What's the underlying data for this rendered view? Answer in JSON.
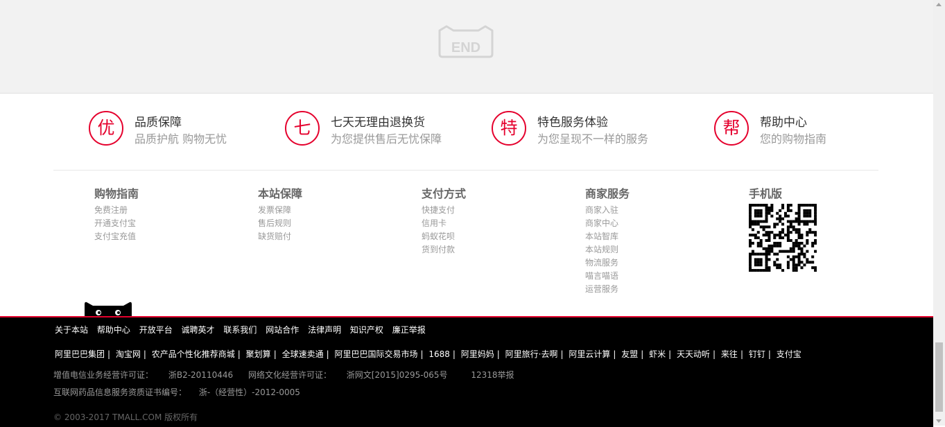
{
  "end_banner": {
    "text": "END"
  },
  "services": [
    {
      "icon_char": "优",
      "title": "品质保障",
      "subtitle": "品质护航 购物无忧"
    },
    {
      "icon_char": "七",
      "title": "七天无理由退换货",
      "subtitle": "为您提供售后无忧保障"
    },
    {
      "icon_char": "特",
      "title": "特色服务体验",
      "subtitle": "为您呈现不一样的服务"
    },
    {
      "icon_char": "帮",
      "title": "帮助中心",
      "subtitle": "您的购物指南"
    }
  ],
  "columns": [
    {
      "title": "购物指南",
      "links": [
        "免费注册",
        "开通支付宝",
        "支付宝充值"
      ]
    },
    {
      "title": "本站保障",
      "links": [
        "发票保障",
        "售后规则",
        "缺货赔付"
      ]
    },
    {
      "title": "支付方式",
      "links": [
        "快捷支付",
        "信用卡",
        "蚂蚁花呗",
        "货到付款"
      ]
    },
    {
      "title": "商家服务",
      "links": [
        "商家入驻",
        "商家中心",
        "本站智库",
        "本站规则",
        "物流服务",
        "喵言喵语",
        "运营服务"
      ]
    },
    {
      "title": "手机版",
      "qr": "qr-code"
    }
  ],
  "footer": {
    "links": [
      "关于本站",
      "帮助中心",
      "开放平台",
      "诚聘英才",
      "联系我们",
      "网站合作",
      "法律声明",
      "知识产权",
      "廉正举报"
    ],
    "partners": [
      "阿里巴巴集团",
      "淘宝网",
      "农产品个性化推荐商城",
      "聚划算",
      "全球速卖通",
      "阿里巴巴国际交易市场",
      "1688",
      "阿里妈妈",
      "阿里旅行·去啊",
      "阿里云计算",
      "友盟",
      "虾米",
      "天天动听",
      "来往",
      "钉钉",
      "支付宝"
    ],
    "license1_label": "增值电信业务经营许可证：",
    "license1_value": "浙B2-20110446",
    "license2_label": "网络文化经营许可证：",
    "license2_value": "浙网文[2015]0295-065号",
    "report": "12318举报",
    "license3_label": "互联网药品信息服务资质证书编号：",
    "license3_value": "浙-（经营性）-2012-0005",
    "copyright": "© 2003-2017 TMALL.COM 版权所有"
  },
  "colors": {
    "accent": "#e5002d",
    "footer_bg": "#000000"
  }
}
